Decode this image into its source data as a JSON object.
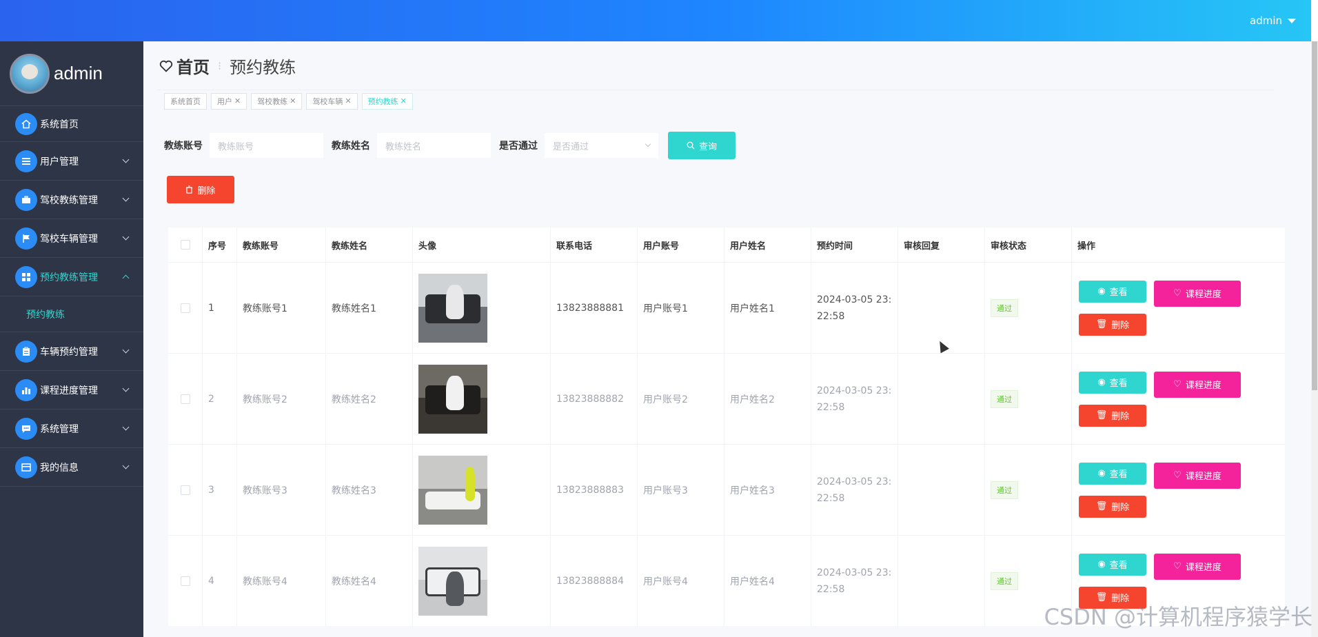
{
  "topbar": {
    "user": "admin"
  },
  "sidebar": {
    "username": "admin",
    "items": [
      {
        "label": "系统首页",
        "icon": "home-icon"
      },
      {
        "label": "用户管理",
        "icon": "list-icon"
      },
      {
        "label": "驾校教练管理",
        "icon": "briefcase-icon"
      },
      {
        "label": "驾校车辆管理",
        "icon": "flag-icon"
      },
      {
        "label": "预约教练管理",
        "icon": "grid-icon"
      },
      {
        "label": "车辆预约管理",
        "icon": "clipboard-icon"
      },
      {
        "label": "课程进度管理",
        "icon": "bar-chart-icon"
      },
      {
        "label": "系统管理",
        "icon": "chat-icon"
      },
      {
        "label": "我的信息",
        "icon": "card-icon"
      }
    ],
    "submenu": {
      "label": "预约教练"
    }
  },
  "breadcrumb": {
    "home": "首页",
    "current": "预约教练"
  },
  "tags": [
    {
      "label": "系统首页"
    },
    {
      "label": "用户"
    },
    {
      "label": "驾校教练"
    },
    {
      "label": "驾校车辆"
    },
    {
      "label": "预约教练"
    }
  ],
  "search": {
    "account_label": "教练账号",
    "account_placeholder": "教练账号",
    "name_label": "教练姓名",
    "name_placeholder": "教练姓名",
    "passed_label": "是否通过",
    "passed_placeholder": "是否通过",
    "query_button": "查询"
  },
  "actions": {
    "delete_button": "删除"
  },
  "table": {
    "headers": [
      "序号",
      "教练账号",
      "教练姓名",
      "头像",
      "联系电话",
      "用户账号",
      "用户姓名",
      "预约时间",
      "审核回复",
      "审核状态",
      "操作"
    ],
    "rows": [
      {
        "index": "1",
        "coach_account": "教练账号1",
        "coach_name": "教练姓名1",
        "phone": "13823888881",
        "user_account": "用户账号1",
        "user_name": "用户姓名1",
        "time_line1": "2024-03-05 23:",
        "time_line2": "22:58",
        "reply": "",
        "status": "通过"
      },
      {
        "index": "2",
        "coach_account": "教练账号2",
        "coach_name": "教练姓名2",
        "phone": "13823888882",
        "user_account": "用户账号2",
        "user_name": "用户姓名2",
        "time_line1": "2024-03-05 23:",
        "time_line2": "22:58",
        "reply": "",
        "status": "通过"
      },
      {
        "index": "3",
        "coach_account": "教练账号3",
        "coach_name": "教练姓名3",
        "phone": "13823888883",
        "user_account": "用户账号3",
        "user_name": "用户姓名3",
        "time_line1": "2024-03-05 23:",
        "time_line2": "22:58",
        "reply": "",
        "status": "通过"
      },
      {
        "index": "4",
        "coach_account": "教练账号4",
        "coach_name": "教练姓名4",
        "phone": "13823888884",
        "user_account": "用户账号4",
        "user_name": "用户姓名4",
        "time_line1": "2024-03-05 23:",
        "time_line2": "22:58",
        "reply": "",
        "status": "通过"
      }
    ],
    "ops": {
      "view": "查看",
      "progress": "课程进度",
      "delete": "删除"
    }
  },
  "watermark": "CSDN @计算机程序猿学长",
  "colors": {
    "accent": "#2fd6cf",
    "danger": "#f5452f",
    "pink": "#f4239b",
    "sidebar": "#2e3547",
    "menu_icon": "#2b8cf5"
  }
}
